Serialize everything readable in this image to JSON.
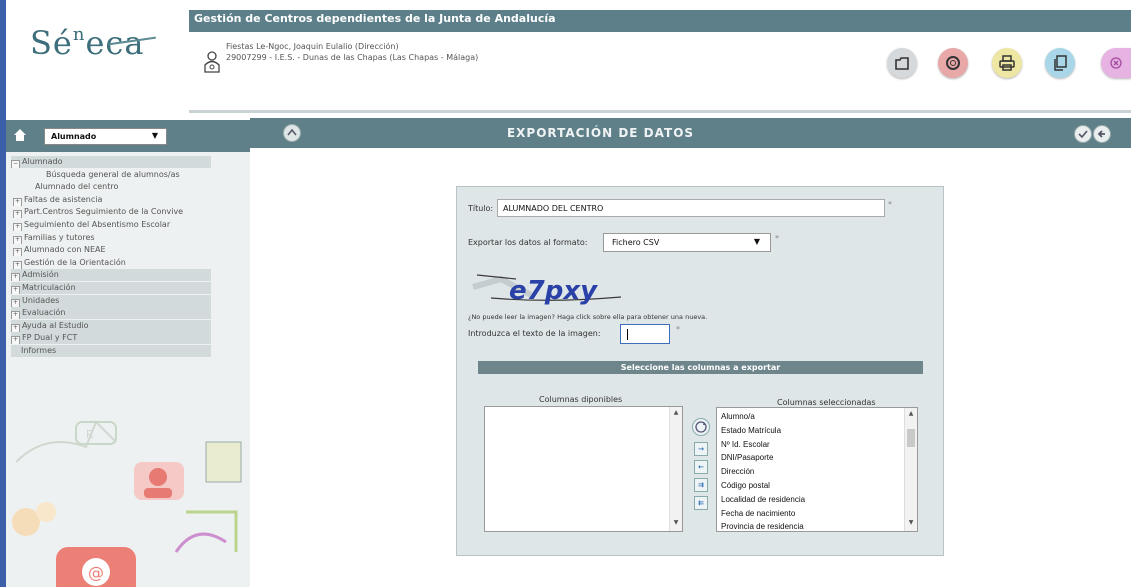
{
  "header": {
    "app_bar_title": "Gestión de Centros dependientes de la Junta de Andalucía",
    "logo_text": "Sé",
    "logo_sup": "n",
    "logo_text2": "eca",
    "user_name": "Fiestas Le-Ngoc, Joaquin Eulalio (Dirección)",
    "user_center": "29007299 - I.E.S. - Dunas de las Chapas (Las Chapas - Málaga)",
    "tools": [
      "open-icon",
      "help-lifebuoy-icon",
      "print-icon",
      "copy-icon",
      "close-icon"
    ]
  },
  "sidebar": {
    "module_selected": "Alumnado",
    "items": [
      {
        "label": "Alumnado",
        "level": "top",
        "expanded": true
      },
      {
        "label": "Búsqueda general de alumnos/as",
        "level": "leaf"
      },
      {
        "label": "Alumnado del centro",
        "level": "leaf"
      },
      {
        "label": "Faltas de asistencia",
        "level": "sub"
      },
      {
        "label": "Part.Centros Seguimiento de la Convive",
        "level": "sub"
      },
      {
        "label": "Seguimiento del Absentismo Escolar",
        "level": "sub"
      },
      {
        "label": "Familias y tutores",
        "level": "sub"
      },
      {
        "label": "Alumnado con NEAE",
        "level": "sub"
      },
      {
        "label": "Gestión de la Orientación",
        "level": "sub"
      },
      {
        "label": "Admisión",
        "level": "top"
      },
      {
        "label": "Matriculación",
        "level": "top"
      },
      {
        "label": "Unidades",
        "level": "top"
      },
      {
        "label": "Evaluación",
        "level": "top"
      },
      {
        "label": "Ayuda al Estudio",
        "level": "top"
      },
      {
        "label": "FP Dual y FCT",
        "level": "top"
      },
      {
        "label": "Informes",
        "level": "top-nobox"
      }
    ]
  },
  "main": {
    "title": "EXPORTACIÓN DE DATOS",
    "form": {
      "titulo_label": "Título:",
      "titulo_value": "ALUMNADO DEL CENTRO",
      "formato_label": "Exportar los datos al formato:",
      "formato_value": "Fichero CSV",
      "captcha_text": "e7pxy",
      "captcha_hint": "¿No puede leer la imagen? Haga click sobre ella para obtener una nueva.",
      "captcha_input_label": "Introduzca el texto de la imagen:",
      "required_mark": "*",
      "section_title": "Seleccione las columnas a exportar",
      "available_title": "Columnas diponibles",
      "selected_title": "Columnas seleccionadas",
      "available_columns": [],
      "selected_columns": [
        "Alumno/a",
        "Estado Matrícula",
        "Nº Id. Escolar",
        "DNI/Pasaporte",
        "Dirección",
        "Código postal",
        "Localidad de residencia",
        "Fecha de nacimiento",
        "Provincia de residencia"
      ]
    }
  },
  "colors": {
    "header_bar": "#5c7f8a",
    "sidebar_header": "#5f7f89",
    "panel_bg": "#dfe6e8",
    "accent_blue": "#3b5fa8"
  }
}
